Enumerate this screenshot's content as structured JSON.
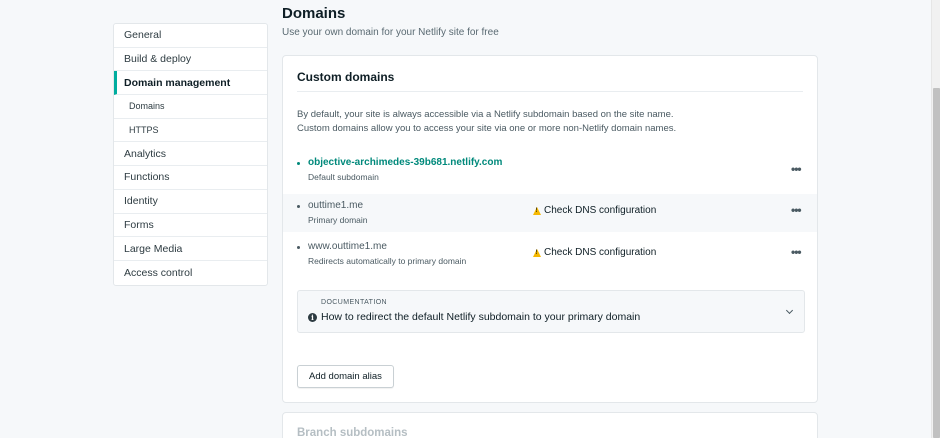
{
  "sidebar": {
    "items": [
      {
        "label": "General"
      },
      {
        "label": "Build & deploy"
      },
      {
        "label": "Domain management"
      },
      {
        "label": "Domains"
      },
      {
        "label": "HTTPS"
      },
      {
        "label": "Analytics"
      },
      {
        "label": "Functions"
      },
      {
        "label": "Identity"
      },
      {
        "label": "Forms"
      },
      {
        "label": "Large Media"
      },
      {
        "label": "Access control"
      }
    ]
  },
  "header": {
    "title": "Domains",
    "subtitle": "Use your own domain for your Netlify site for free"
  },
  "custom_domains": {
    "title": "Custom domains",
    "description_line1": "By default, your site is always accessible via a Netlify subdomain based on the site name.",
    "description_line2": "Custom domains allow you to access your site via one or more non-Netlify domain names.",
    "domains": [
      {
        "name": "objective-archimedes-39b681.netlify.com",
        "sub": "Default subdomain",
        "warning": ""
      },
      {
        "name": "outtime1.me",
        "sub": "Primary domain",
        "warning": "Check DNS configuration"
      },
      {
        "name": "www.outtime1.me",
        "sub": "Redirects automatically to primary domain",
        "warning": "Check DNS configuration"
      }
    ],
    "documentation": {
      "label": "DOCUMENTATION",
      "title": "How to redirect the default Netlify subdomain to your primary domain"
    },
    "add_alias_label": "Add domain alias"
  },
  "branch_subdomains": {
    "title": "Branch subdomains"
  },
  "colors": {
    "accent": "#00ad9f",
    "link": "#00897b",
    "warning": "#f5b800"
  }
}
